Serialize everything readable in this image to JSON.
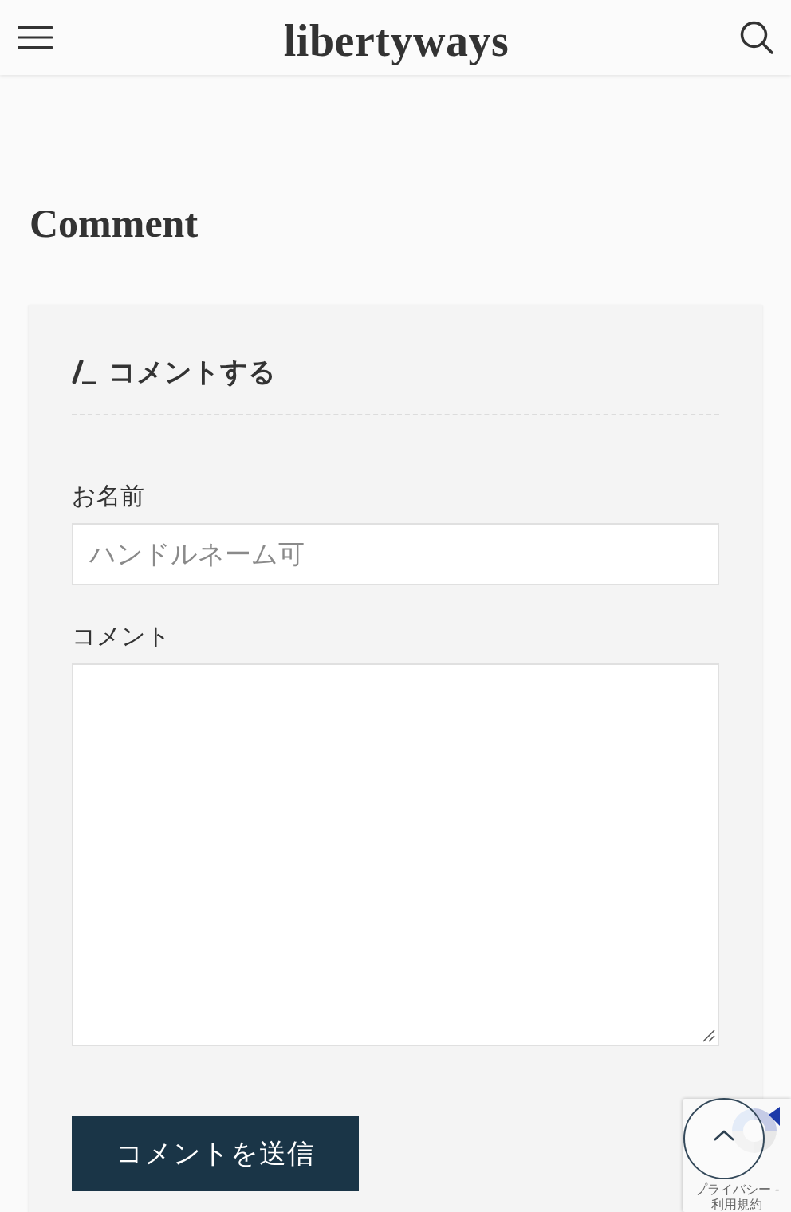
{
  "header": {
    "logo": "libertyways"
  },
  "section_title": "Comment",
  "form": {
    "title": "コメントする",
    "fields": [
      {
        "kind": "text",
        "label": "お名前",
        "placeholder": "ハンドルネーム可"
      },
      {
        "kind": "textarea",
        "label": "コメント"
      }
    ],
    "submit": "コメントを送信"
  },
  "recaptcha": {
    "links": [
      "プライバシー -",
      "利用規約"
    ]
  }
}
